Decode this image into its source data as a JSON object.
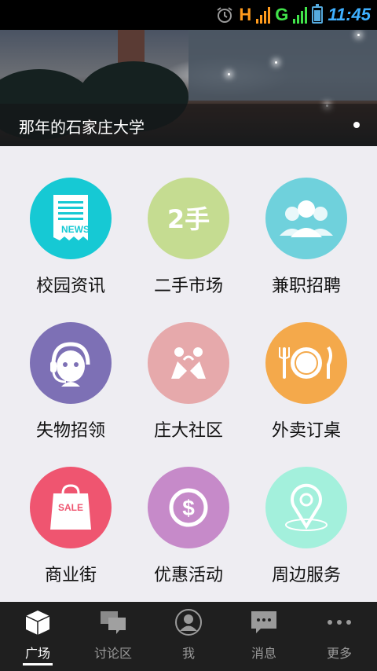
{
  "status_bar": {
    "network_1": "H",
    "network_2": "G",
    "time": "11:45",
    "icons": [
      "alarm-icon",
      "signal-icon",
      "battery-icon"
    ]
  },
  "banner": {
    "caption": "那年的石家庄大学",
    "page_dots": 1
  },
  "grid": {
    "items": [
      {
        "label": "校园资讯",
        "icon": "news-icon",
        "color": "#16c9d4"
      },
      {
        "label": "二手市场",
        "icon": "second-hand-icon",
        "color": "#c5dc91"
      },
      {
        "label": "兼职招聘",
        "icon": "people-icon",
        "color": "#6fd1dc"
      },
      {
        "label": "失物招领",
        "icon": "support-agent-icon",
        "color": "#7d70b5"
      },
      {
        "label": "庄大社区",
        "icon": "community-icon",
        "color": "#e6a9ab"
      },
      {
        "label": "外卖订桌",
        "icon": "dining-icon",
        "color": "#f4a94b"
      },
      {
        "label": "商业街",
        "icon": "shopping-bag-icon",
        "color": "#ef5570"
      },
      {
        "label": "优惠活动",
        "icon": "dollar-icon",
        "color": "#c68ac9"
      },
      {
        "label": "周边服务",
        "icon": "location-icon",
        "color": "#a3f0dc"
      }
    ],
    "news_text": "NEWS",
    "second_hand_text": "2手",
    "sale_text": "SALE"
  },
  "tabbar": {
    "tabs": [
      {
        "label": "广场",
        "icon": "cube-icon",
        "active": true
      },
      {
        "label": "讨论区",
        "icon": "chat-icon",
        "active": false
      },
      {
        "label": "我",
        "icon": "user-icon",
        "active": false
      },
      {
        "label": "消息",
        "icon": "message-icon",
        "active": false
      },
      {
        "label": "更多",
        "icon": "more-icon",
        "active": false
      }
    ]
  }
}
